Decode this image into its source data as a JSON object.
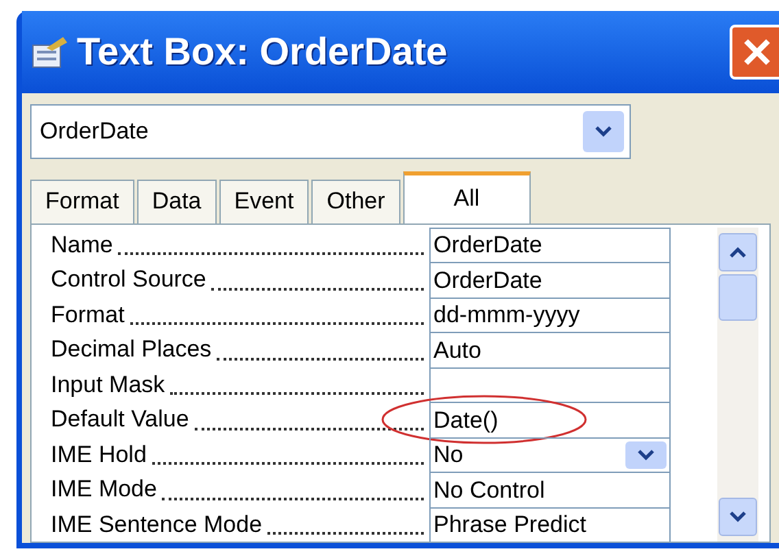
{
  "window": {
    "title": "Text Box: OrderDate"
  },
  "object_selector": {
    "value": "OrderDate"
  },
  "tabs": [
    {
      "label": "Format",
      "selected": false
    },
    {
      "label": "Data",
      "selected": false
    },
    {
      "label": "Event",
      "selected": false
    },
    {
      "label": "Other",
      "selected": false
    },
    {
      "label": "All",
      "selected": true
    }
  ],
  "properties": [
    {
      "name": "Name",
      "value": "OrderDate",
      "kind": "text",
      "circled": false
    },
    {
      "name": "Control Source",
      "value": "OrderDate",
      "kind": "text",
      "circled": false
    },
    {
      "name": "Format",
      "value": "dd-mmm-yyyy",
      "kind": "text",
      "circled": false
    },
    {
      "name": "Decimal Places",
      "value": "Auto",
      "kind": "text",
      "circled": false
    },
    {
      "name": "Input Mask",
      "kind": "text",
      "circled": false
    },
    {
      "name": "Default Value",
      "value": "Date()",
      "kind": "text",
      "circled": true
    },
    {
      "name": "IME Hold",
      "value": "No",
      "kind": "dropdown",
      "circled": false
    },
    {
      "name": "IME Mode",
      "value": "No Control",
      "kind": "text",
      "circled": false
    },
    {
      "name": "IME Sentence Mode",
      "value": "Phrase Predict",
      "kind": "text",
      "circled": false
    }
  ]
}
